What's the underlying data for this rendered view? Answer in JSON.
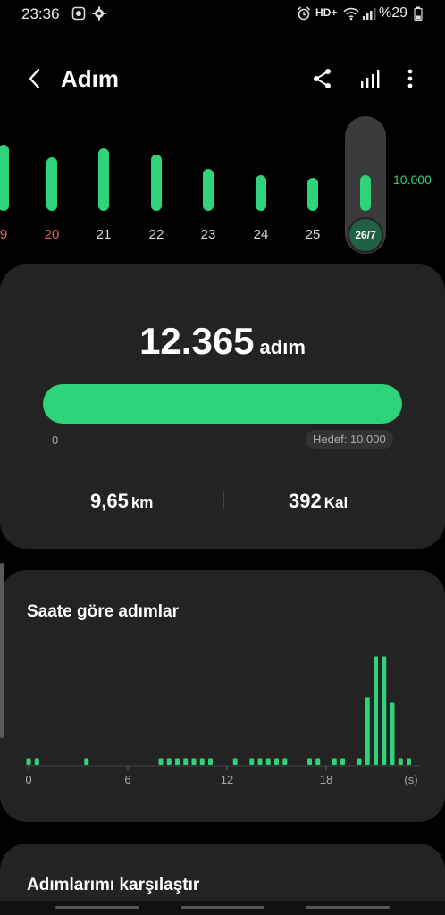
{
  "status_bar": {
    "time": "23:36",
    "network_label": "HD+",
    "battery": "%29"
  },
  "header": {
    "title": "Adım",
    "icons": [
      "back-arrow-icon",
      "share-icon",
      "bar-chart-icon",
      "more-vert-icon"
    ]
  },
  "day_strip": {
    "goal_label": "10.000",
    "days": [
      {
        "label": "9",
        "steps_fraction": 0.74,
        "weekend": true
      },
      {
        "label": "20",
        "steps_fraction": 0.6,
        "weekend": true
      },
      {
        "label": "21",
        "steps_fraction": 0.7,
        "weekend": false
      },
      {
        "label": "22",
        "steps_fraction": 0.63,
        "weekend": false
      },
      {
        "label": "23",
        "steps_fraction": 0.47,
        "weekend": false
      },
      {
        "label": "24",
        "steps_fraction": 0.4,
        "weekend": false
      },
      {
        "label": "25",
        "steps_fraction": 0.37,
        "weekend": false
      }
    ],
    "selected": {
      "label": "26/7",
      "steps_fraction": 0.4
    }
  },
  "summary": {
    "steps_value": "12.365",
    "steps_unit": "adım",
    "progress_percent": 100,
    "progress_min": "0",
    "goal_text": "Hedef: 10.000",
    "distance_value": "9,65",
    "distance_unit": "km",
    "calories_value": "392",
    "calories_unit": "Kal"
  },
  "hourly": {
    "title": "Saate göre adımlar",
    "x_ticks": [
      "0",
      "6",
      "12",
      "18",
      "(s)"
    ],
    "tick_hours": [
      0,
      6,
      12,
      18
    ],
    "bars": [
      {
        "h": 0.0,
        "v": 0.06
      },
      {
        "h": 0.5,
        "v": 0.06
      },
      {
        "h": 3.5,
        "v": 0.06
      },
      {
        "h": 8.0,
        "v": 0.06
      },
      {
        "h": 8.5,
        "v": 0.06
      },
      {
        "h": 9.0,
        "v": 0.06
      },
      {
        "h": 9.5,
        "v": 0.06
      },
      {
        "h": 10.0,
        "v": 0.06
      },
      {
        "h": 10.5,
        "v": 0.06
      },
      {
        "h": 11.0,
        "v": 0.06
      },
      {
        "h": 12.5,
        "v": 0.06
      },
      {
        "h": 13.5,
        "v": 0.06
      },
      {
        "h": 14.0,
        "v": 0.06
      },
      {
        "h": 14.5,
        "v": 0.06
      },
      {
        "h": 15.0,
        "v": 0.06
      },
      {
        "h": 15.5,
        "v": 0.06
      },
      {
        "h": 17.0,
        "v": 0.06
      },
      {
        "h": 17.5,
        "v": 0.06
      },
      {
        "h": 18.5,
        "v": 0.06
      },
      {
        "h": 19.0,
        "v": 0.06
      },
      {
        "h": 20.0,
        "v": 0.06
      },
      {
        "h": 20.5,
        "v": 0.61
      },
      {
        "h": 21.0,
        "v": 0.98
      },
      {
        "h": 21.5,
        "v": 0.98
      },
      {
        "h": 22.0,
        "v": 0.56
      },
      {
        "h": 22.5,
        "v": 0.06
      },
      {
        "h": 23.0,
        "v": 0.06
      }
    ]
  },
  "compare": {
    "title": "Adımlarımı karşılaştır"
  },
  "colors": {
    "accent": "#2fd47a",
    "card": "#232323",
    "weekend": "#e0605a"
  }
}
